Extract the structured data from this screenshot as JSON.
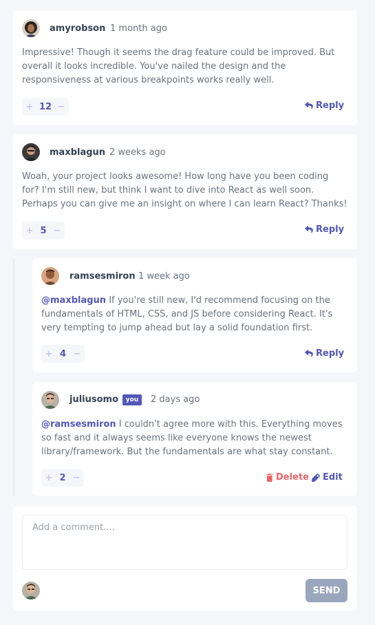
{
  "comments": [
    {
      "username": "amyrobson",
      "time": "1 month ago",
      "text": "Impressive! Though it seems the drag feature could be improved. But overall it looks incredible. You've nailed the design and the responsiveness at various breakpoints works really well.",
      "score": "12",
      "plus": "+",
      "minus": "−",
      "reply_label": "Reply"
    },
    {
      "username": "maxblagun",
      "time": "2 weeks ago",
      "text": "Woah, your project looks awesome! How long have you been coding for? I'm still new, but think I want to dive into React as well soon. Perhaps you can give me an insight on where I can learn React? Thanks!",
      "score": "5",
      "plus": "+",
      "minus": "−",
      "reply_label": "Reply"
    }
  ],
  "replies": [
    {
      "username": "ramsesmiron",
      "time": "1 week ago",
      "mention": "@maxblagun",
      "text": " If you're still new, I'd recommend focusing on the fundamentals of HTML, CSS, and JS before considering React. It's very tempting to jump ahead but lay a solid foundation first.",
      "score": "4",
      "plus": "+",
      "minus": "−",
      "reply_label": "Reply"
    },
    {
      "username": "juliusomo",
      "you_badge": "you",
      "time": "2 days ago",
      "mention": "@ramsesmiron",
      "text": " I couldn't agree more with this. Everything moves so fast and it always seems like everyone knows the newest library/framework. But the fundamentals are what stay constant.",
      "score": "2",
      "plus": "+",
      "minus": "−",
      "delete_label": "Delete",
      "edit_label": "Edit"
    }
  ],
  "composer": {
    "placeholder": "Add a comment....",
    "send_label": "SEND"
  },
  "icons": {
    "reply": "reply-icon",
    "delete": "trash-icon",
    "edit": "pencil-icon"
  },
  "colors": {
    "primary": "#5357b6",
    "danger": "#ed6368",
    "send_disabled": "#9aa6bd",
    "background": "#f5f6fa"
  }
}
